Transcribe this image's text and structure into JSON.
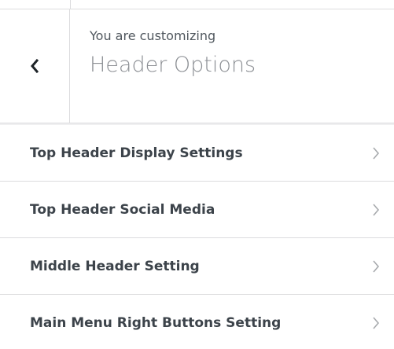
{
  "header": {
    "back_icon": "chevron-left-icon",
    "customizing_label": "You are customizing",
    "section_title": "Header Options"
  },
  "menu": {
    "items": [
      {
        "label": "Top Header Display Settings",
        "icon": "chevron-right-icon"
      },
      {
        "label": "Top Header Social Media",
        "icon": "chevron-right-icon"
      },
      {
        "label": "Middle Header Setting",
        "icon": "chevron-right-icon"
      },
      {
        "label": "Main Menu Right Buttons Setting",
        "icon": "chevron-right-icon"
      }
    ]
  },
  "colors": {
    "border": "#dcdcde",
    "gap_band": "#f0f0f1",
    "label_text": "#3c434a",
    "title_text": "#8c8f94",
    "chevron": "#a7aaad"
  }
}
